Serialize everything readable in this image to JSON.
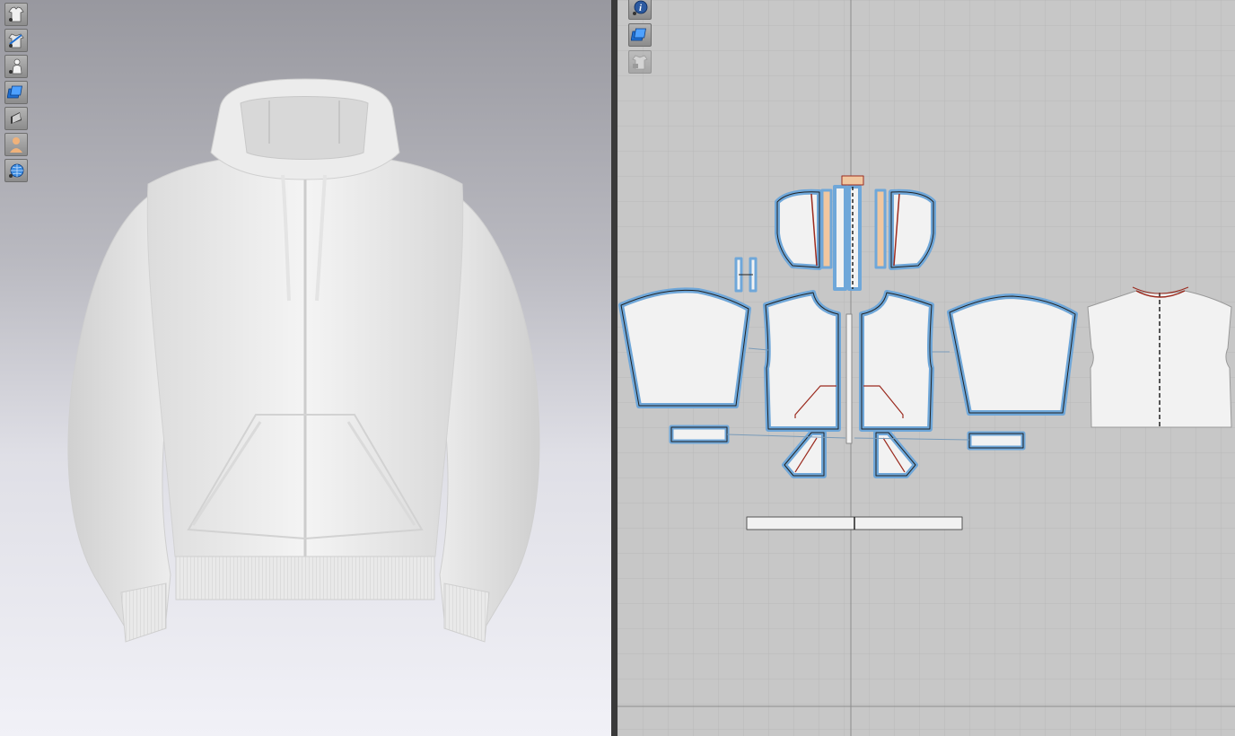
{
  "app": {
    "panels": [
      "3d-garment-window",
      "2d-pattern-window"
    ]
  },
  "toolbar_3d": {
    "items": [
      {
        "icon": "garment-display-icon"
      },
      {
        "icon": "garment-texture-icon"
      },
      {
        "icon": "avatar-display-icon"
      },
      {
        "icon": "fabric-render-icon"
      },
      {
        "icon": "lighting-icon"
      },
      {
        "icon": "avatar-skin-icon"
      },
      {
        "icon": "environment-globe-icon"
      }
    ]
  },
  "toolbar_2d": {
    "items": [
      {
        "icon": "info-icon"
      },
      {
        "icon": "fabric-render-icon"
      },
      {
        "icon": "garment-lock-icon",
        "disabled": true
      }
    ]
  },
  "colors": {
    "pattern_outline": "#6fa7d9",
    "pattern_fill": "#f2f2f2",
    "seam_line": "#9b2b1f",
    "grid_bg": "#c7c7c7",
    "grid_line": "#b4b4b4",
    "garment": "#f0f0f0"
  }
}
